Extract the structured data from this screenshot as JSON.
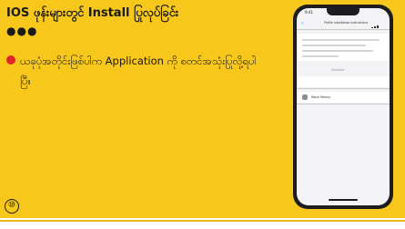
{
  "slide": {
    "title": "IOS ဖုန်းများတွင် Install ပြုလုပ်ခြင်း",
    "dots": "●●●",
    "body": "ယခုပုံအတိုင်းဖြစ်ပါက Application ကို စတင်အသုံးပြုလို့ရပါပြီ။",
    "page_number": "⑩",
    "colors": {
      "background": "#f7c81b",
      "bullet": "#e0262b",
      "text": "#1a1a1a"
    }
  },
  "phone": {
    "status_time": "9:41",
    "nav_back_icon": "chevron-left-icon",
    "nav_title": "Profile Installation Instructions",
    "section_label": "Installed",
    "row_label": "Wave Money"
  }
}
